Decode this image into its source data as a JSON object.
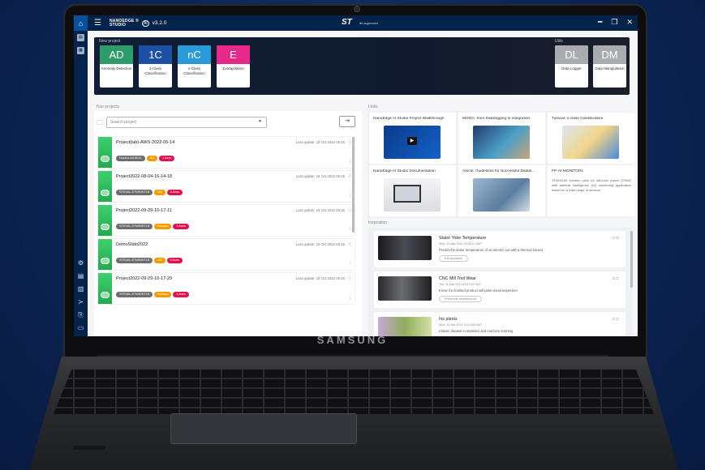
{
  "device": {
    "brand": "SAMSUNG"
  },
  "app": {
    "title_line1": "NANOEDGE ®",
    "title_line2": "STUDIO",
    "ai_badge": "AI",
    "version": "v3.2.0",
    "brand_logo": "ST",
    "brand_tagline": "life.augmented"
  },
  "hero": {
    "new_project_label": "New project",
    "utils_label": "Utils",
    "tiles": [
      {
        "abbr": "AD",
        "label": "Anomaly Detection",
        "color": "#2e9c6a"
      },
      {
        "abbr": "1C",
        "label": "1-Class Classification",
        "color": "#1d4fa5"
      },
      {
        "abbr": "nC",
        "label": "n-Class Classification",
        "color": "#2a9ad8"
      },
      {
        "abbr": "E",
        "label": "Extrapolation",
        "color": "#e6298a"
      }
    ],
    "utils": [
      {
        "abbr": "DL",
        "label": "Data Logger",
        "color": "#a9abb0"
      },
      {
        "abbr": "DM",
        "label": "Data Manipulation",
        "color": "#a9abb0"
      }
    ]
  },
  "projects": {
    "section_label": "Your projects",
    "search_placeholder": "Search project",
    "items": [
      {
        "name": "Project(lab)-AWS-2022-06-14",
        "updated": "Last update: 18 Oct 2022 05:45",
        "tags": [
          {
            "label": "Nucleo-WL55JC",
            "kind": "grey"
          },
          {
            "label": "AD",
            "kind": "or"
          },
          {
            "label": "1 Axes",
            "kind": "red"
          }
        ]
      },
      {
        "name": "Project2022-08-04-16-14-18",
        "updated": "Last update: 18 Oct 2022 05:45",
        "tags": [
          {
            "label": "STEVAL-STWINKT1B",
            "kind": "grey"
          },
          {
            "label": "AD",
            "kind": "or"
          },
          {
            "label": "3 Axes",
            "kind": "red"
          }
        ]
      },
      {
        "name": "Project2022-09-29-10-17-11",
        "updated": "Last update: 18 Oct 2022 05:45",
        "tags": [
          {
            "label": "STEVAL-STWINKT1B",
            "kind": "grey"
          },
          {
            "label": "Extrapo",
            "kind": "or"
          },
          {
            "label": "3 Axes",
            "kind": "red"
          }
        ]
      },
      {
        "name": "DemoSlido2022",
        "updated": "Last update: 18 Oct 2022 05:45",
        "tags": [
          {
            "label": "STEVAL-STWINKT1B",
            "kind": "grey"
          },
          {
            "label": "AD",
            "kind": "or"
          },
          {
            "label": "3 Axes",
            "kind": "red"
          }
        ]
      },
      {
        "name": "Project2022-09-29-10-17-29",
        "updated": "Last update: 18 Oct 2022 05:45",
        "tags": [
          {
            "label": "STEVAL-STWINKT1B",
            "kind": "grey"
          },
          {
            "label": "Extrapo",
            "kind": "or"
          },
          {
            "label": "3 Axes",
            "kind": "red"
          }
        ]
      }
    ]
  },
  "links": {
    "section_label": "Links",
    "items": [
      {
        "title": "NanoEdge AI Studio Project Walkthrough",
        "thumb": "video"
      },
      {
        "title": "MOOC: from Datalogging to integration",
        "thumb": "hands"
      },
      {
        "title": "Tutorial: n-class Classification",
        "thumb": "kids"
      },
      {
        "title": "NanoEdge AI Studio Documentation",
        "thumb": "desk"
      },
      {
        "title": "Article: Guidelines for Successful Datalo...",
        "thumb": "lab"
      },
      {
        "title": "FP-AI-MONITOR1",
        "desc": "STM32Lite function pack for ultra-low power STM32 with artificial intelligence (AI) monitoring application based on a wide range of sensors"
      }
    ]
  },
  "inspiration": {
    "section_label": "Inspiration",
    "items": [
      {
        "title": "Stator Yoke Temperature",
        "date": "Wed, 31 Mar 2021 08:00:11 GMT",
        "desc": "Predict the stator temperature of an electric car with a thermal sensor",
        "chip": "Extrapolation",
        "thumb": "#2b2b2f"
      },
      {
        "title": "CNC Mill Tool Wear",
        "date": "Thu, 11 Mar 2021 09:37:23 GMT",
        "desc": "Know if a finished product will pass visual inspection",
        "chip": "Predictive maintenance",
        "thumb": "#3a3a3c"
      },
      {
        "title": "Iris plants",
        "date": "Wed, 31 Mar 2021 10:11:08 GMT",
        "desc": "Classic dataset in statistics and machine learning",
        "chip": "",
        "thumb": "#8fae5a"
      }
    ]
  }
}
